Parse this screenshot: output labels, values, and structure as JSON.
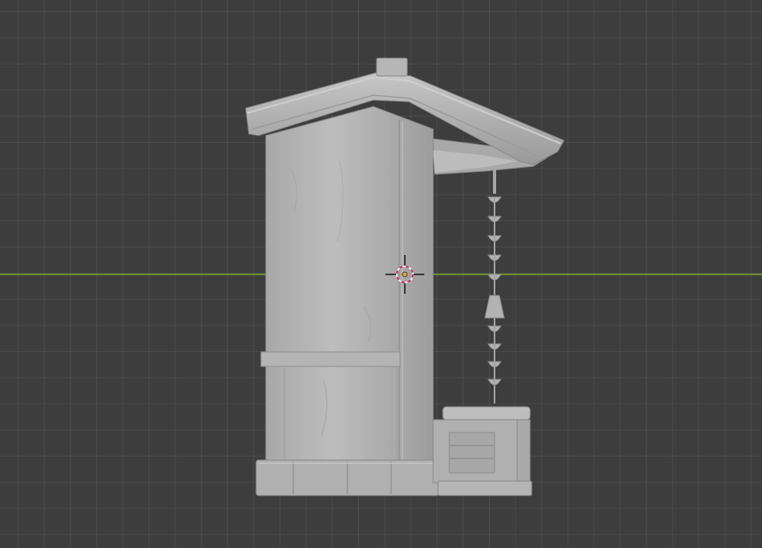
{
  "viewport": {
    "background": "#3d3d3d",
    "grid_color": "#4a4a4a",
    "x_axis_color": "#6f8d2f",
    "model_color": "#b8b8b8",
    "cursor_ring_colors": [
      "#e0e0e0",
      "#d4285a"
    ],
    "cursor_center_color": "#e8a23a"
  },
  "scene": {
    "object": "shrine-well",
    "shading": "solid"
  }
}
